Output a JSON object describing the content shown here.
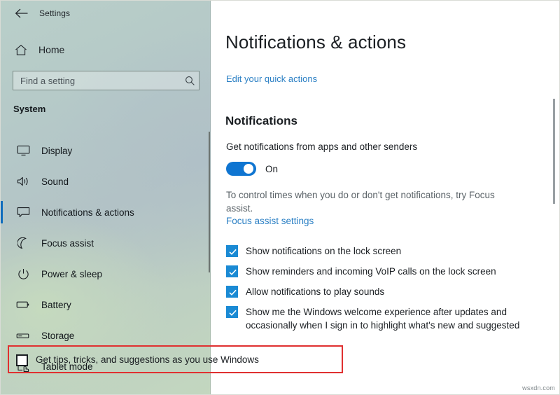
{
  "window": {
    "app_title": "Settings",
    "back_icon": "back-arrow-icon",
    "minimize_label": "─",
    "maximize_label": "□",
    "close_label": "✕"
  },
  "sidebar": {
    "home_label": "Home",
    "home_icon": "home-icon",
    "search": {
      "placeholder": "Find a setting",
      "value": "",
      "icon": "search-icon"
    },
    "section_label": "System",
    "accent_color": "#0f6cbd",
    "items": [
      {
        "label": "Display",
        "icon": "monitor-icon",
        "selected": false
      },
      {
        "label": "Sound",
        "icon": "speaker-icon",
        "selected": false
      },
      {
        "label": "Notifications & actions",
        "icon": "chat-bubble-icon",
        "selected": true
      },
      {
        "label": "Focus assist",
        "icon": "moon-icon",
        "selected": false
      },
      {
        "label": "Power & sleep",
        "icon": "power-icon",
        "selected": false
      },
      {
        "label": "Battery",
        "icon": "battery-icon",
        "selected": false
      },
      {
        "label": "Storage",
        "icon": "drive-icon",
        "selected": false
      },
      {
        "label": "Tablet mode",
        "icon": "tablet-touch-icon",
        "selected": false
      }
    ]
  },
  "main": {
    "page_title": "Notifications & actions",
    "quick_actions_link": "Edit your quick actions",
    "notifications_heading": "Notifications",
    "get_notifications_caption": "Get notifications from apps and other senders",
    "toggle": {
      "state_label": "On",
      "checked": true,
      "accent_color": "#0f75d1"
    },
    "helper_text": "To control times when you do or don't get notifications, try Focus assist.",
    "focus_assist_link": "Focus assist settings",
    "checkboxes": [
      {
        "label": "Show notifications on the lock screen",
        "checked": true
      },
      {
        "label": "Show reminders and incoming VoIP calls on the lock screen",
        "checked": true
      },
      {
        "label": "Allow notifications to play sounds",
        "checked": true
      },
      {
        "label": "Show me the Windows welcome experience after updates and occasionally when I sign in to highlight what's new and suggested",
        "checked": true
      }
    ],
    "highlighted_checkbox": {
      "label": "Get tips, tricks, and suggestions as you use Windows",
      "checked": false,
      "highlight_color": "#e03030"
    }
  },
  "watermark": "wsxdn.com"
}
